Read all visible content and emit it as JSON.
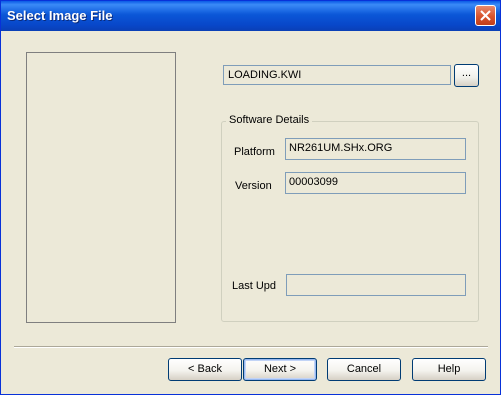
{
  "window": {
    "title": "Select Image File"
  },
  "file": {
    "value": "LOADING.KWI",
    "browse_label": "..."
  },
  "software_details": {
    "legend": "Software Details",
    "platform_label": "Platform",
    "platform_value": "NR261UM.SHx.ORG",
    "version_label": "Version",
    "version_value": "00003099",
    "last_upd_label": "Last Upd",
    "last_upd_value": ""
  },
  "buttons": {
    "back": "< Back",
    "next": "Next >",
    "cancel": "Cancel",
    "help": "Help"
  }
}
